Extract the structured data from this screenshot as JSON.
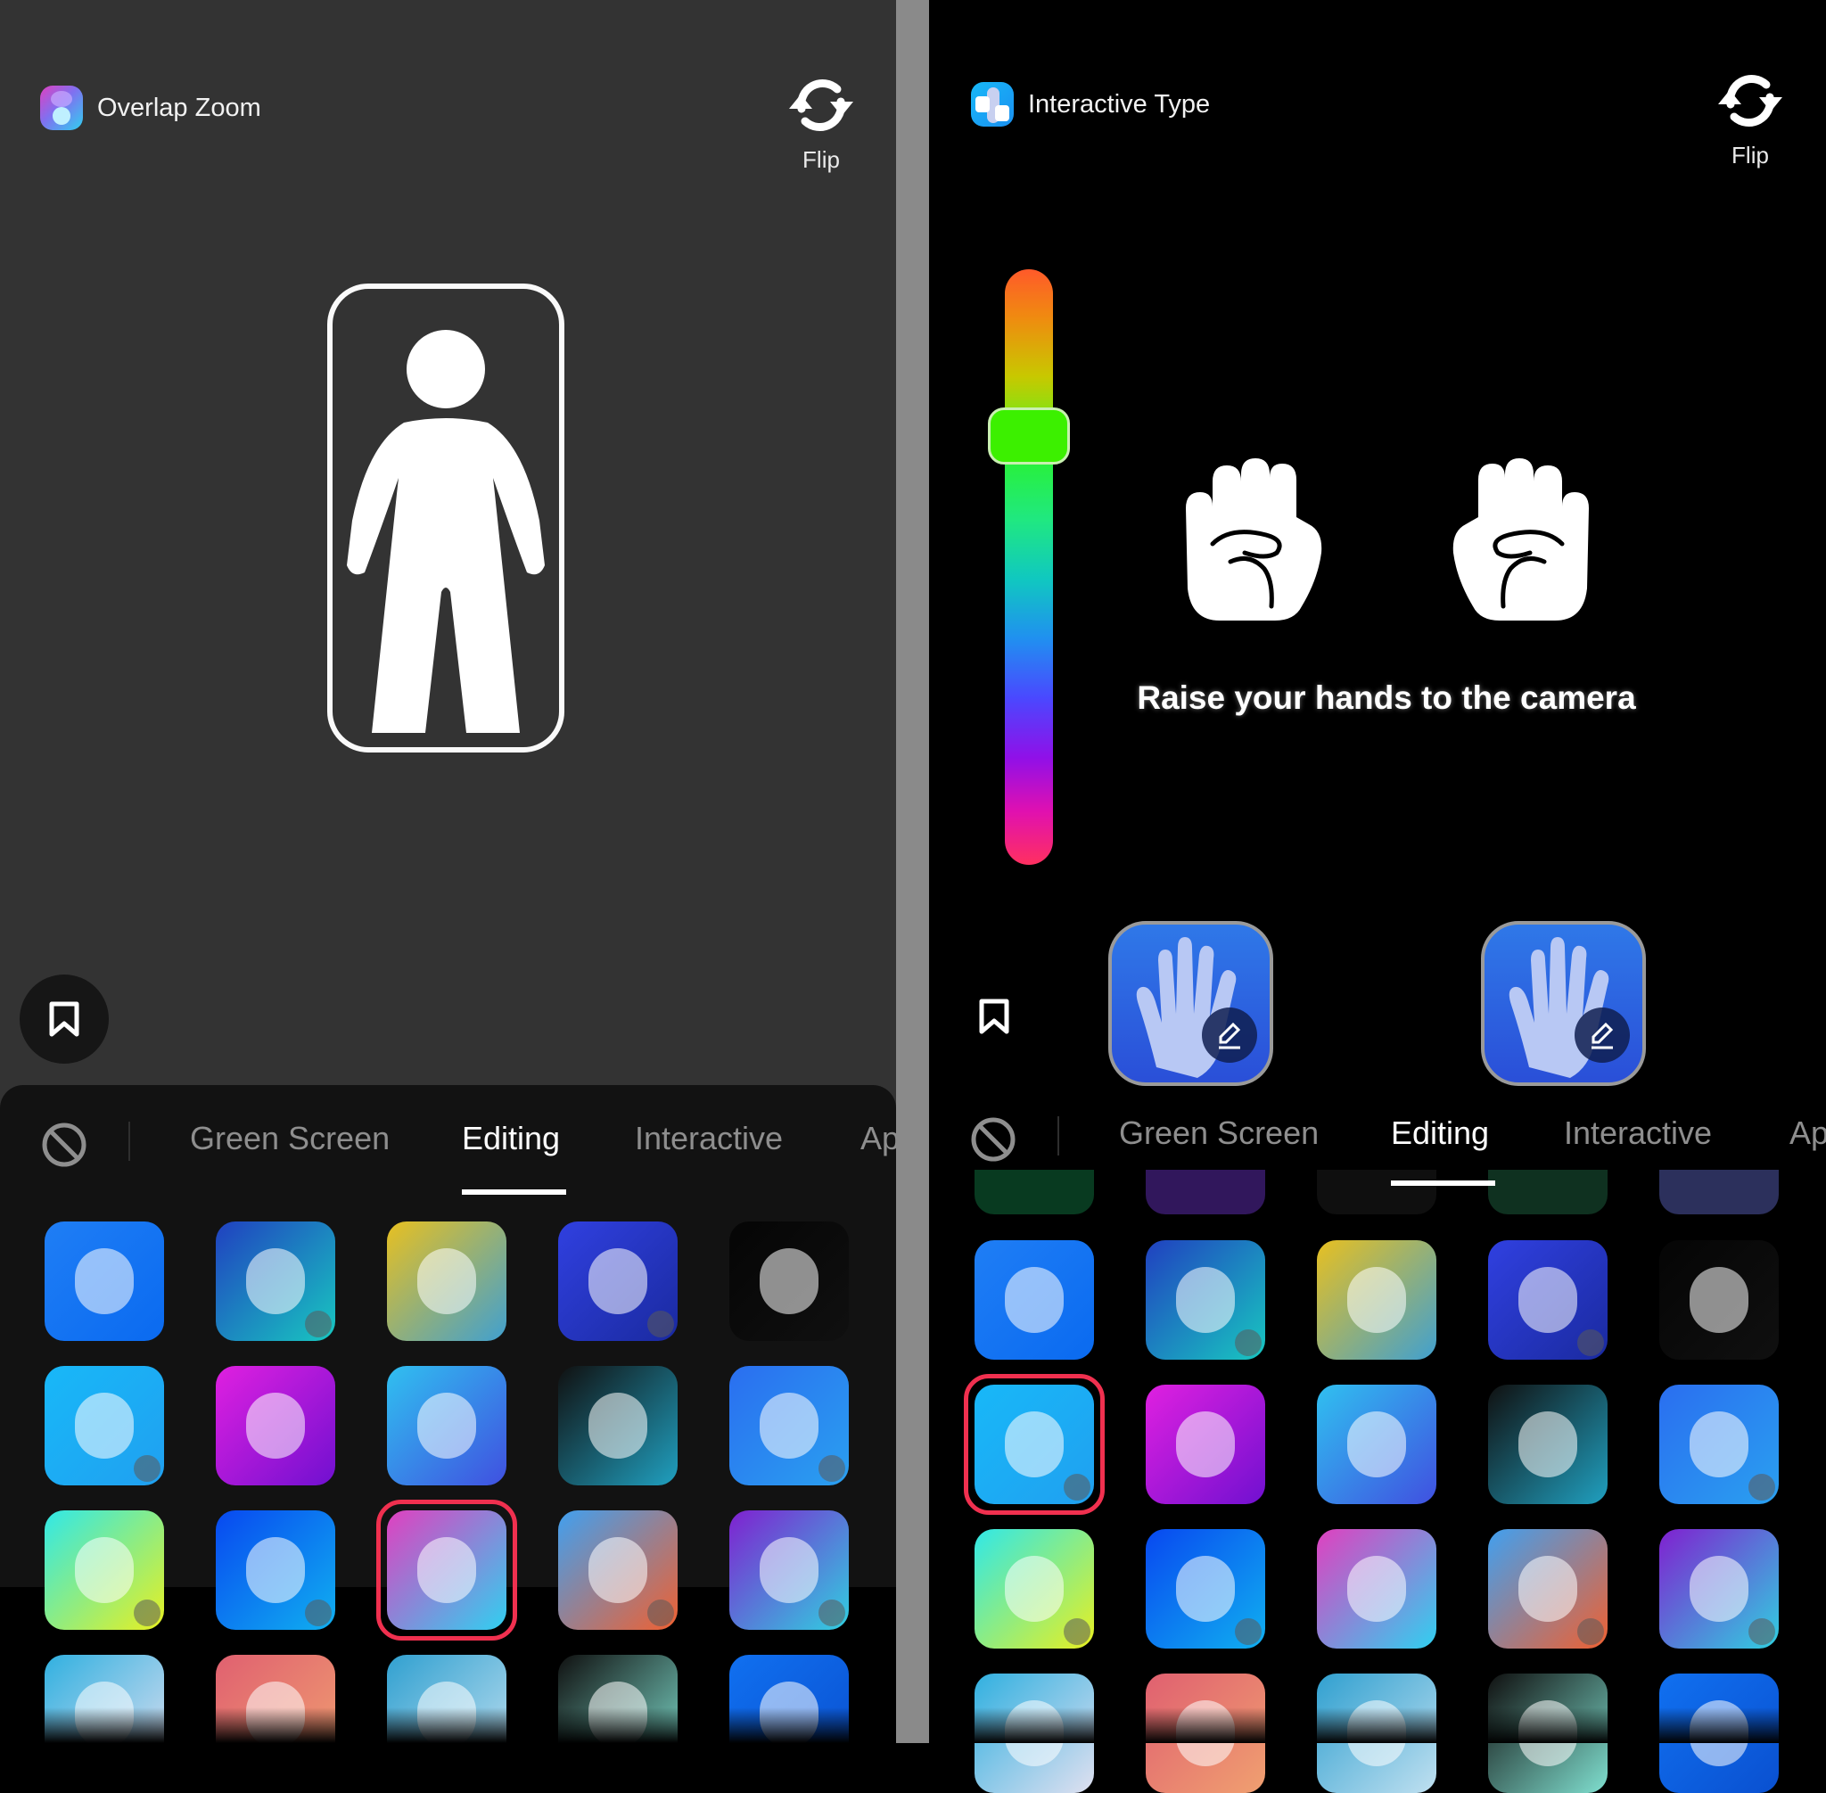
{
  "left_screen": {
    "effect_name": "Overlap Zoom",
    "effect_icon": "overlap-zoom-icon",
    "flip_label": "Flip",
    "camera_prompt_icon": "person-silhouette-frame-icon",
    "bookmark_icon": "bookmark-icon",
    "tabs": [
      {
        "label": "Green Screen",
        "active": false
      },
      {
        "label": "Editing",
        "active": true
      },
      {
        "label": "Interactive",
        "active": false
      },
      {
        "label": "Ap",
        "active": false
      }
    ],
    "selected_tile": {
      "row": 3,
      "col": 3,
      "effect": "Overlap Zoom"
    }
  },
  "right_screen": {
    "effect_name": "Interactive Type",
    "effect_icon": "interactive-type-icon",
    "flip_label": "Flip",
    "color_slider": {
      "value_fraction_from_top": 0.28,
      "handle_color": "#3cf000"
    },
    "hint_text": "Raise your hands to the camera",
    "hand_buttons": [
      {
        "name": "left-hand-text-button",
        "icon": "hand-edit-icon"
      },
      {
        "name": "right-hand-text-button",
        "icon": "hand-edit-icon"
      }
    ],
    "bookmark_icon": "bookmark-icon",
    "tabs": [
      {
        "label": "Green Screen",
        "active": false
      },
      {
        "label": "Editing",
        "active": true
      },
      {
        "label": "Interactive",
        "active": false
      },
      {
        "label": "Ap",
        "active": false
      }
    ],
    "selected_tile": {
      "row": 2,
      "col": 1,
      "effect": "Interactive Type"
    }
  },
  "effects_grid": [
    {
      "name": "connect-dots-house",
      "bg": [
        "#1f7ef5",
        "#0a6af0"
      ],
      "download": false
    },
    {
      "name": "blob-face-touch",
      "bg": [
        "#2040c0",
        "#18c8c0"
      ],
      "download": true
    },
    {
      "name": "photo-collage-clones",
      "bg": [
        "#e8c020",
        "#40a0d0"
      ],
      "download": false
    },
    {
      "name": "scan-lines-face",
      "bg": [
        "#3040e0",
        "#1a2aa0"
      ],
      "download": true
    },
    {
      "name": "text-expand",
      "bg": [
        "#050505",
        "#101010"
      ],
      "download": false
    },
    {
      "name": "interactive-type",
      "bg": [
        "#18b8f8",
        "#20a0f0"
      ],
      "download": true
    },
    {
      "name": "face-swap-crack",
      "bg": [
        "#e020e0",
        "#7010d0"
      ],
      "download": false
    },
    {
      "name": "rotate-orb",
      "bg": [
        "#30c0f0",
        "#4050e0"
      ],
      "download": false
    },
    {
      "name": "lens-50mm",
      "bg": [
        "#101010",
        "#20a0c0"
      ],
      "download": false
    },
    {
      "name": "zoom-face-scan",
      "bg": [
        "#2a6ef0",
        "#2aa0f0"
      ],
      "download": true
    },
    {
      "name": "timer-text-toggle",
      "bg": [
        "#30e8e8",
        "#e8f020"
      ],
      "download": true
    },
    {
      "name": "question-tiles-swipe",
      "bg": [
        "#0848f0",
        "#10b0f0"
      ],
      "download": true
    },
    {
      "name": "overlap-zoom",
      "bg": [
        "#e040c0",
        "#30d0f0"
      ],
      "download": false
    },
    {
      "name": "peel-paper-touch",
      "bg": [
        "#40a0f0",
        "#f06030"
      ],
      "download": true
    },
    {
      "name": "split-wave-person",
      "bg": [
        "#8020d0",
        "#30d0e0"
      ],
      "download": true
    },
    {
      "name": "shout-burst",
      "bg": [
        "#30b0e0",
        "#e0e0f0"
      ],
      "download": false
    },
    {
      "name": "sparkle-moon-face",
      "bg": [
        "#e06070",
        "#f0a070"
      ],
      "download": false
    },
    {
      "name": "shattered-glass-hand",
      "bg": [
        "#30a0d0",
        "#c0e0f0"
      ],
      "download": false
    },
    {
      "name": "wink-eyes-stretch",
      "bg": [
        "#101010",
        "#80e0d0"
      ],
      "download": false
    },
    {
      "name": "tap-expand-arrows",
      "bg": [
        "#1070f0",
        "#0a50d0"
      ],
      "download": false
    }
  ],
  "peek_row_right": [
    {
      "bg": "#0f6a3a"
    },
    {
      "bg": "#5a2aa8"
    },
    {
      "bg": "#1c1c1c"
    },
    {
      "bg": "#1b5a3a"
    },
    {
      "bg": "#5058a8"
    }
  ],
  "colors": {
    "left_bg": "#333333",
    "right_bg": "#000000",
    "divider": "#8a8a8a",
    "sheet": "#121212",
    "selection_ring": "#f0304f",
    "tab_inactive": "#8e8e8e",
    "tab_active": "#ffffff"
  }
}
